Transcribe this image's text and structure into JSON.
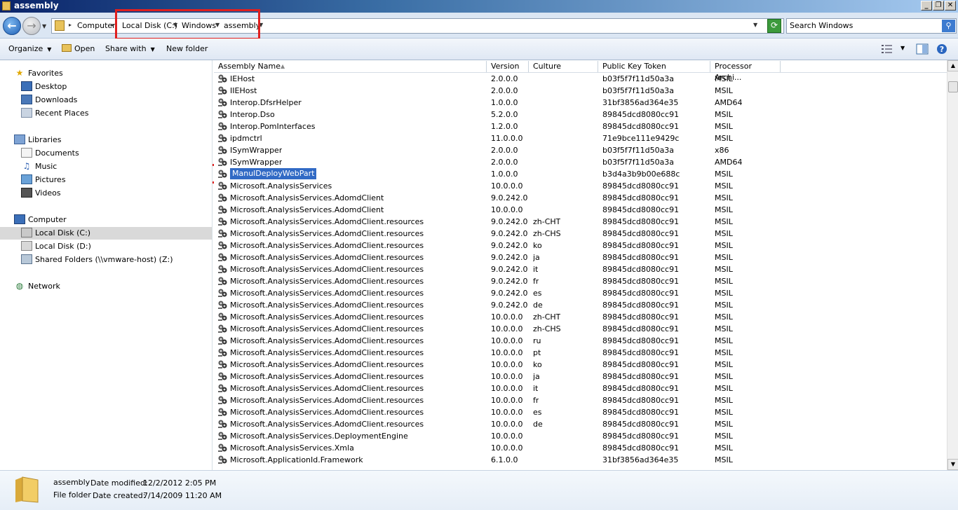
{
  "window": {
    "title": "assembly"
  },
  "address": {
    "crumbs": [
      "Computer",
      "Local Disk (C:)",
      "Windows",
      "assembly"
    ],
    "search_placeholder": "Search Windows"
  },
  "toolbar": {
    "organize": "Organize",
    "open": "Open",
    "share_with": "Share with",
    "new_folder": "New folder"
  },
  "nav": {
    "favorites": "Favorites",
    "desktop": "Desktop",
    "downloads": "Downloads",
    "recent": "Recent Places",
    "libraries": "Libraries",
    "documents": "Documents",
    "music": "Music",
    "pictures": "Pictures",
    "videos": "Videos",
    "computer": "Computer",
    "local_c": "Local Disk (C:)",
    "local_d": "Local Disk (D:)",
    "shared": "Shared Folders (\\\\vmware-host) (Z:)",
    "network": "Network"
  },
  "columns": [
    "Assembly Name",
    "Version",
    "Culture",
    "Public Key Token",
    "Processor Archi..."
  ],
  "rows": [
    [
      "IEHost",
      "2.0.0.0",
      "",
      "b03f5f7f11d50a3a",
      "MSIL"
    ],
    [
      "IIEHost",
      "2.0.0.0",
      "",
      "b03f5f7f11d50a3a",
      "MSIL"
    ],
    [
      "Interop.DfsrHelper",
      "1.0.0.0",
      "",
      "31bf3856ad364e35",
      "AMD64"
    ],
    [
      "Interop.Dso",
      "5.2.0.0",
      "",
      "89845dcd8080cc91",
      "MSIL"
    ],
    [
      "Interop.PomInterfaces",
      "1.2.0.0",
      "",
      "89845dcd8080cc91",
      "MSIL"
    ],
    [
      "ipdmctrl",
      "11.0.0.0",
      "",
      "71e9bce111e9429c",
      "MSIL"
    ],
    [
      "ISymWrapper",
      "2.0.0.0",
      "",
      "b03f5f7f11d50a3a",
      "x86"
    ],
    [
      "ISymWrapper",
      "2.0.0.0",
      "",
      "b03f5f7f11d50a3a",
      "AMD64"
    ],
    [
      "ManulDeployWebPart",
      "1.0.0.0",
      "",
      "b3d4a3b9b00e688c",
      "MSIL"
    ],
    [
      "Microsoft.AnalysisServices",
      "10.0.0.0",
      "",
      "89845dcd8080cc91",
      "MSIL"
    ],
    [
      "Microsoft.AnalysisServices.AdomdClient",
      "9.0.242.0",
      "",
      "89845dcd8080cc91",
      "MSIL"
    ],
    [
      "Microsoft.AnalysisServices.AdomdClient",
      "10.0.0.0",
      "",
      "89845dcd8080cc91",
      "MSIL"
    ],
    [
      "Microsoft.AnalysisServices.AdomdClient.resources",
      "9.0.242.0",
      "zh-CHT",
      "89845dcd8080cc91",
      "MSIL"
    ],
    [
      "Microsoft.AnalysisServices.AdomdClient.resources",
      "9.0.242.0",
      "zh-CHS",
      "89845dcd8080cc91",
      "MSIL"
    ],
    [
      "Microsoft.AnalysisServices.AdomdClient.resources",
      "9.0.242.0",
      "ko",
      "89845dcd8080cc91",
      "MSIL"
    ],
    [
      "Microsoft.AnalysisServices.AdomdClient.resources",
      "9.0.242.0",
      "ja",
      "89845dcd8080cc91",
      "MSIL"
    ],
    [
      "Microsoft.AnalysisServices.AdomdClient.resources",
      "9.0.242.0",
      "it",
      "89845dcd8080cc91",
      "MSIL"
    ],
    [
      "Microsoft.AnalysisServices.AdomdClient.resources",
      "9.0.242.0",
      "fr",
      "89845dcd8080cc91",
      "MSIL"
    ],
    [
      "Microsoft.AnalysisServices.AdomdClient.resources",
      "9.0.242.0",
      "es",
      "89845dcd8080cc91",
      "MSIL"
    ],
    [
      "Microsoft.AnalysisServices.AdomdClient.resources",
      "9.0.242.0",
      "de",
      "89845dcd8080cc91",
      "MSIL"
    ],
    [
      "Microsoft.AnalysisServices.AdomdClient.resources",
      "10.0.0.0",
      "zh-CHT",
      "89845dcd8080cc91",
      "MSIL"
    ],
    [
      "Microsoft.AnalysisServices.AdomdClient.resources",
      "10.0.0.0",
      "zh-CHS",
      "89845dcd8080cc91",
      "MSIL"
    ],
    [
      "Microsoft.AnalysisServices.AdomdClient.resources",
      "10.0.0.0",
      "ru",
      "89845dcd8080cc91",
      "MSIL"
    ],
    [
      "Microsoft.AnalysisServices.AdomdClient.resources",
      "10.0.0.0",
      "pt",
      "89845dcd8080cc91",
      "MSIL"
    ],
    [
      "Microsoft.AnalysisServices.AdomdClient.resources",
      "10.0.0.0",
      "ko",
      "89845dcd8080cc91",
      "MSIL"
    ],
    [
      "Microsoft.AnalysisServices.AdomdClient.resources",
      "10.0.0.0",
      "ja",
      "89845dcd8080cc91",
      "MSIL"
    ],
    [
      "Microsoft.AnalysisServices.AdomdClient.resources",
      "10.0.0.0",
      "it",
      "89845dcd8080cc91",
      "MSIL"
    ],
    [
      "Microsoft.AnalysisServices.AdomdClient.resources",
      "10.0.0.0",
      "fr",
      "89845dcd8080cc91",
      "MSIL"
    ],
    [
      "Microsoft.AnalysisServices.AdomdClient.resources",
      "10.0.0.0",
      "es",
      "89845dcd8080cc91",
      "MSIL"
    ],
    [
      "Microsoft.AnalysisServices.AdomdClient.resources",
      "10.0.0.0",
      "de",
      "89845dcd8080cc91",
      "MSIL"
    ],
    [
      "Microsoft.AnalysisServices.DeploymentEngine",
      "10.0.0.0",
      "",
      "89845dcd8080cc91",
      "MSIL"
    ],
    [
      "Microsoft.AnalysisServices.Xmla",
      "10.0.0.0",
      "",
      "89845dcd8080cc91",
      "MSIL"
    ],
    [
      "Microsoft.ApplicationId.Framework",
      "6.1.0.0",
      "",
      "31bf3856ad364e35",
      "MSIL"
    ]
  ],
  "selected_row": 8,
  "details": {
    "name": "assembly",
    "type": "File folder",
    "modified_label": "Date modified:",
    "modified": "12/2/2012 2:05 PM",
    "created_label": "Date created:",
    "created": "7/14/2009 11:20 AM"
  },
  "icons": {
    "back": "back-arrow-icon",
    "forward": "forward-arrow-icon",
    "search": "search-icon",
    "folder": "folder-icon",
    "assembly": "gac-assembly-icon"
  },
  "colors": {
    "selection": "#316ac5",
    "highlight_box": "#e0201f",
    "title_bar": "#0a246a"
  }
}
